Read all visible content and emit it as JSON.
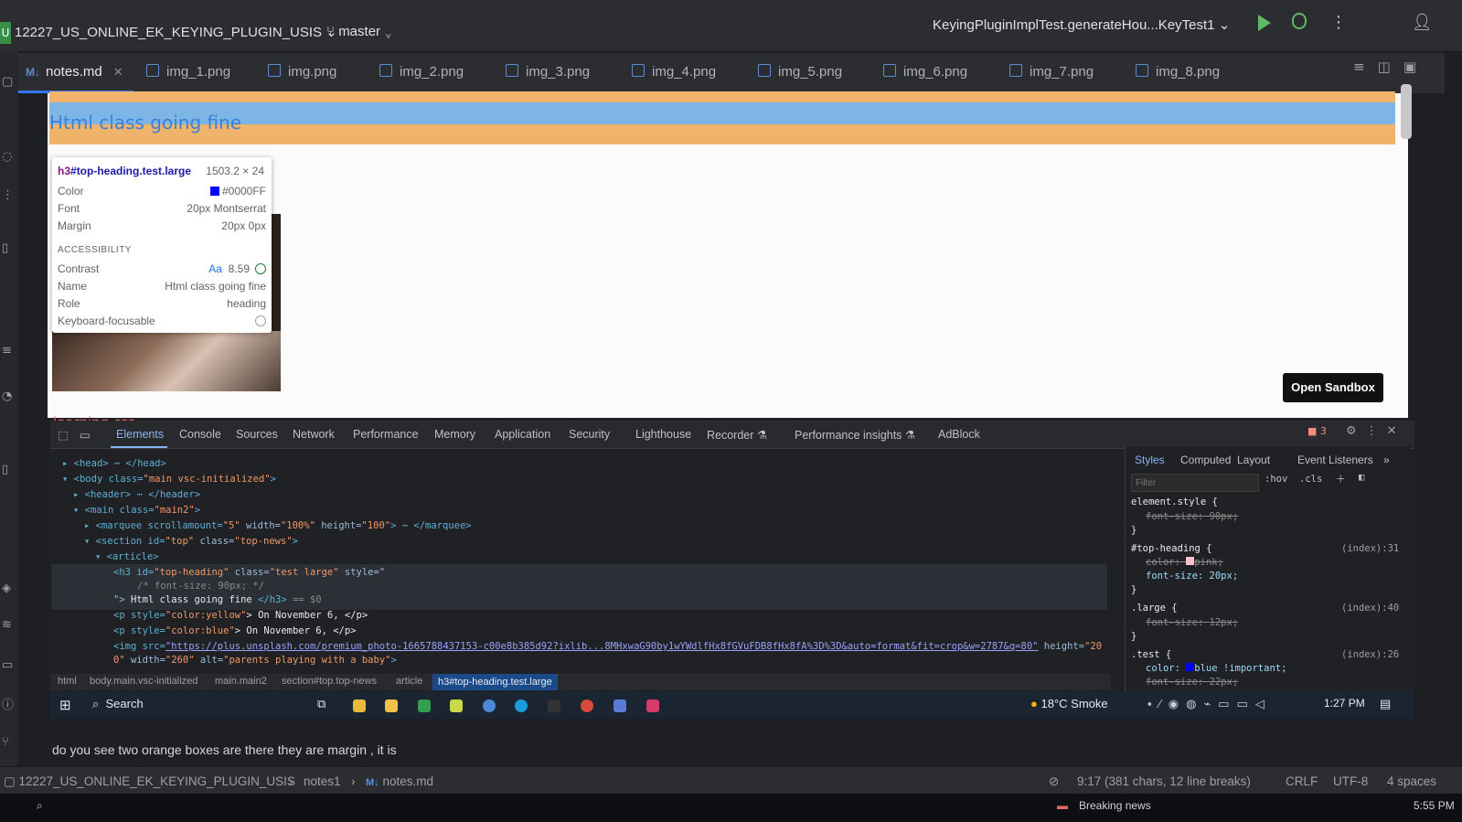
{
  "titlebar": {
    "project_badge": "U",
    "project_name": "12227_US_ONLINE_EK_KEYING_PLUGIN_USIS",
    "branch": "master",
    "run_config": "KeyingPluginImplTest.generateHou...KeyTest1"
  },
  "tabs": [
    {
      "label": "notes.md",
      "badge": "M↓"
    },
    {
      "label": "img_1.png"
    },
    {
      "label": "img.png"
    },
    {
      "label": "img_2.png"
    },
    {
      "label": "img_3.png"
    },
    {
      "label": "img_4.png"
    },
    {
      "label": "img_5.png"
    },
    {
      "label": "img_6.png"
    },
    {
      "label": "img_7.png"
    },
    {
      "label": "img_8.png"
    }
  ],
  "preview": {
    "heading": "Html class going fine",
    "cut_text": "learning css",
    "open_sandbox": "Open Sandbox",
    "tooltip": {
      "selector_tag": "h3",
      "selector_rest": "#top-heading.test.large",
      "dimensions": "1503.2 × 24",
      "color_label": "Color",
      "color_value": "#0000FF",
      "font_label": "Font",
      "font_value": "20px Montserrat",
      "margin_label": "Margin",
      "margin_value": "20px 0px",
      "accessibility": "ACCESSIBILITY",
      "contrast_label": "Contrast",
      "contrast_aa": "Aa",
      "contrast_value": "8.59",
      "name_label": "Name",
      "name_value": "Html class going fine",
      "role_label": "Role",
      "role_value": "heading",
      "kbd_label": "Keyboard-focusable"
    }
  },
  "devtools": {
    "tabs": [
      "Elements",
      "Console",
      "Sources",
      "Network",
      "Performance",
      "Memory",
      "Application",
      "Security",
      "Lighthouse",
      "Recorder ⚗",
      "Performance insights ⚗",
      "AdBlock"
    ],
    "error_count": "3",
    "dom": {
      "l1": "<head> ⋯ </head>",
      "l2a": "<body class=",
      "l2b": "\"main vsc-initialized\"",
      "l2c": ">",
      "l3": "<header> ⋯ </header>",
      "l4a": "<main class=",
      "l4b": "\"main2\"",
      "l4c": ">",
      "l5a": "<marquee scrollamount=",
      "l5b": "\"5\"",
      "l5c": " width=",
      "l5d": "\"100%\"",
      "l5e": " height=",
      "l5f": "\"100\"",
      "l5g": "> ⋯ </marquee>",
      "l6a": "<section id=",
      "l6b": "\"top\"",
      "l6c": " class=",
      "l6d": "\"top-news\"",
      "l6e": ">",
      "l7": "<article>",
      "l8a": "<h3 id=",
      "l8b": "\"top-heading\"",
      "l8c": " class=",
      "l8d": "\"test large\"",
      "l8e": " style=\"",
      "l9": "/* font-size: 90px; */",
      "l10a": "\">",
      "l10b": " Html class going fine ",
      "l10c": "</h3>",
      "l10d": " == $0",
      "l11a": "<p style=",
      "l11b": "\"color:yellow\"",
      "l11c": "> On November 6, </p>",
      "l12a": "<p style=",
      "l12b": "\"color:blue\"",
      "l12c": "> On November 6, </p>",
      "l13a": "<img src=",
      "l13b": "\"https://plus.unsplash.com/premium_photo-1665788437153-c00e8b385d92?ixlib...8MHxwaG90by1wYWdlfHx8fGVuFDB8fHx8fA%3D%3D&auto=format&fit=crop&w=2787&q=80\"",
      "l13c": " height=",
      "l13d": "\"20",
      "l14a": "0\"",
      "l14b": " width=",
      "l14c": "\"260\"",
      "l14d": " alt=",
      "l14e": "\"parents  playing with a baby\"",
      "l14f": ">"
    },
    "breadcrumbs": [
      "html",
      "body.main.vsc-initialized",
      "main.main2",
      "section#top.top-news",
      "article",
      "h3#top-heading.test.large"
    ],
    "styles": {
      "tabs": [
        "Styles",
        "Computed",
        "Layout",
        "Event Listeners",
        "»"
      ],
      "filter_placeholder": "Filter",
      "hov": ":hov",
      "cls": ".cls",
      "element_style": "element.style {",
      "es_prop": "font-size: 90px;",
      "close": "}",
      "r1_sel": "#top-heading {",
      "r1_src": "(index):31",
      "r1_p1": "color: ",
      "r1_p1v": "pink;",
      "r1_p2": "font-size: 20px;",
      "r2_sel": ".large {",
      "r2_src": "(index):40",
      "r2_p1": "font-size: 12px;",
      "r3_sel": ".test {",
      "r3_src": "(index):26",
      "r3_p1": "color: ",
      "r3_p1v": "blue !important;",
      "r3_p2": "font-size: 22px;"
    }
  },
  "taskbar": {
    "search": "Search",
    "weather": "18°C  Smoke",
    "time": "1:27 PM"
  },
  "markdown_text": "do you see two orange boxes are there they are margin , it is",
  "statusbar": {
    "path_project": "12227_US_ONLINE_EK_KEYING_PLUGIN_USIS",
    "path_folder": "notes1",
    "path_file": "notes.md",
    "position": "9:17 (381 chars, 12 line breaks)",
    "line_ending": "CRLF",
    "encoding": "UTF-8",
    "indent": "4 spaces"
  },
  "bottom_strip": {
    "news": "Breaking news",
    "time": "5:55 PM"
  },
  "colors": {
    "accent": "#3574f0",
    "orange_margin": "#efb36b",
    "blue_heading_bg": "#7db6e6",
    "run_green": "#5fb865"
  }
}
